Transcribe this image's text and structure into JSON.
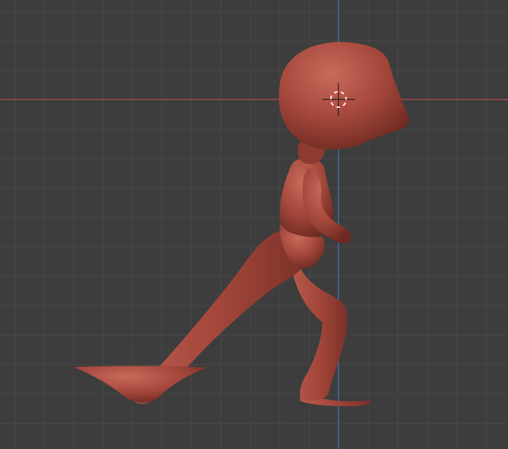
{
  "viewport": {
    "mode": "sculpt",
    "view": "side-orthographic",
    "grid_visible": true,
    "colors": {
      "background": "#3d3d3d",
      "grid_line": "#474747",
      "x_axis": "#b34a50",
      "z_axis": "#3f6fb8",
      "mesh_base": "#a8493d",
      "mesh_highlight": "#c8685a",
      "mesh_shadow": "#6e2a22",
      "cursor_ring_a": "#ffffff",
      "cursor_ring_b": "#d23a3a"
    }
  },
  "scene": {
    "object": "sculpted-walking-character",
    "icons": {
      "cursor": "3d-cursor-icon"
    }
  }
}
